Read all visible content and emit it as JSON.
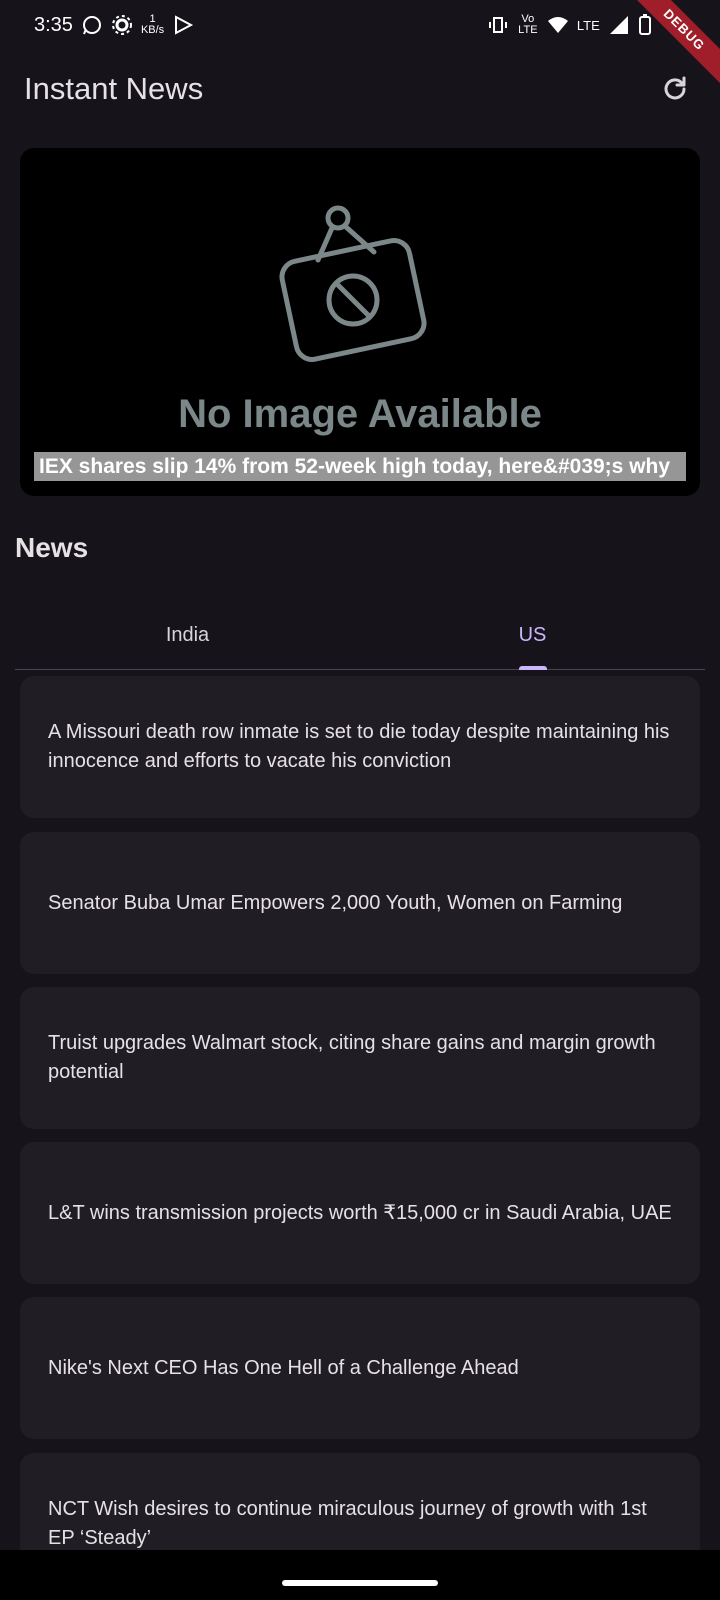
{
  "status": {
    "time": "3:35",
    "net_speed_value": "1",
    "net_speed_unit": "KB/s",
    "volte": "Vo LTE",
    "lte": "LTE",
    "battery": "16"
  },
  "debug_banner": "DEBUG",
  "app_bar": {
    "title": "Instant News"
  },
  "hero": {
    "placeholder_text": "No Image Available",
    "caption": "IEX shares slip 14% from 52-week high today, here&#039;s why"
  },
  "section": {
    "title": "News"
  },
  "tabs": [
    {
      "label": "India",
      "active": false
    },
    {
      "label": "US",
      "active": true
    }
  ],
  "articles": [
    {
      "title": "A Missouri death row inmate is set to die today despite maintaining his innocence and efforts to vacate his conviction"
    },
    {
      "title": "Senator Buba Umar Empowers 2,000 Youth, Women on Farming"
    },
    {
      "title": "Truist upgrades Walmart stock, citing share gains and margin growth potential"
    },
    {
      "title": "L&T wins transmission projects worth ₹15,000 cr in Saudi Arabia, UAE"
    },
    {
      "title": "Nike's Next CEO Has One Hell of a Challenge Ahead"
    },
    {
      "title": "NCT Wish desires to continue miraculous journey of growth with 1st EP ‘Steady’"
    }
  ],
  "colors": {
    "background": "#16141a",
    "card": "#201e24",
    "accent": "#c9b6ff",
    "debug_ribbon": "#a01e2a"
  }
}
